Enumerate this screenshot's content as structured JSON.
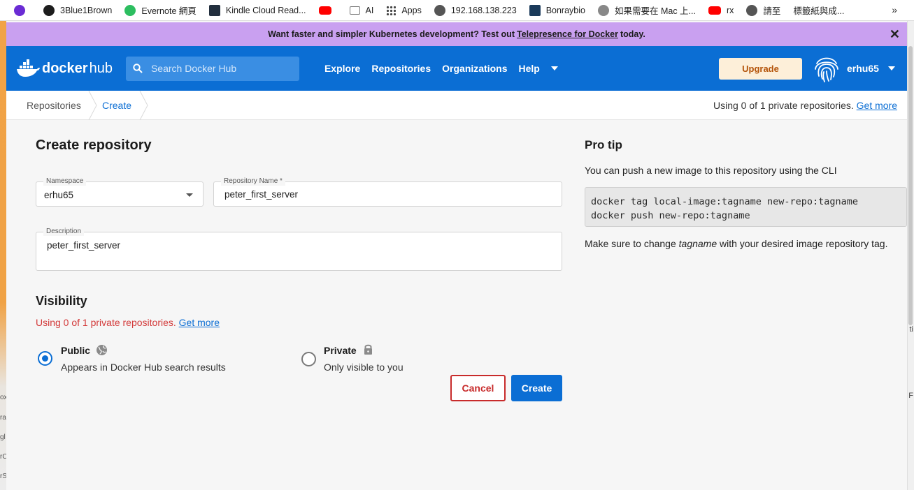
{
  "bookmarks": [
    {
      "label": "",
      "color": "#6a2bd4"
    },
    {
      "label": "3Blue1Brown",
      "color": "#1d1d1d"
    },
    {
      "label": "Evernote 網頁",
      "color": "#2dbe60"
    },
    {
      "label": "Kindle Cloud Read...",
      "color": "#222f3e"
    },
    {
      "label": "",
      "color": "#ff0000"
    },
    {
      "label": "AI",
      "color": "#777777"
    },
    {
      "label": "Apps",
      "color": "#444444"
    },
    {
      "label": "192.168.138.223",
      "color": "#555555"
    },
    {
      "label": "Bonraybio",
      "color": "#1a3a5a"
    },
    {
      "label": "如果需要在 Mac 上...",
      "color": "#888888"
    },
    {
      "label": "rx",
      "color": "#ff0000"
    },
    {
      "label": "請至",
      "color": "#555555"
    },
    {
      "label": "標籤紙與成...",
      "color": "#555555"
    }
  ],
  "bookmarks_more": "»",
  "promo": {
    "before": "Want faster and simpler Kubernetes development? Test out",
    "link": "Telepresence for Docker",
    "after": "today."
  },
  "header": {
    "logo_a": "docker",
    "logo_b": "hub",
    "search_placeholder": "Search Docker Hub",
    "nav": [
      "Explore",
      "Repositories",
      "Organizations",
      "Help"
    ],
    "upgrade": "Upgrade",
    "username": "erhu65"
  },
  "breadcrumb": {
    "items": [
      "Repositories",
      "Create"
    ],
    "usage": "Using 0 of 1 private repositories.",
    "usage_link": "Get more"
  },
  "form": {
    "title": "Create repository",
    "namespace_label": "Namespace",
    "namespace_value": "erhu65",
    "repo_label": "Repository Name *",
    "repo_value": "peter_first_server",
    "desc_label": "Description",
    "desc_value": "peter_first_server",
    "visibility_title": "Visibility",
    "visibility_usage": "Using 0 of 1 private repositories.",
    "visibility_link": "Get more",
    "public_title": "Public",
    "public_sub": "Appears in Docker Hub search results",
    "private_title": "Private",
    "private_sub": "Only visible to you",
    "selected": "public",
    "cancel": "Cancel",
    "create": "Create"
  },
  "protip": {
    "title": "Pro tip",
    "intro": "You can push a new image to this repository using the CLI",
    "code_line1": "docker tag local-image:tagname new-repo:tagname",
    "code_line2": "docker push new-repo:tagname",
    "note_before": "Make sure to change",
    "note_em": "tagname",
    "note_after": "with your desired image repository tag."
  },
  "desktop_fragments": [
    "ox",
    "ra",
    "gl",
    "rC",
    "rS"
  ],
  "right_fragments": [
    "ti",
    "F"
  ]
}
